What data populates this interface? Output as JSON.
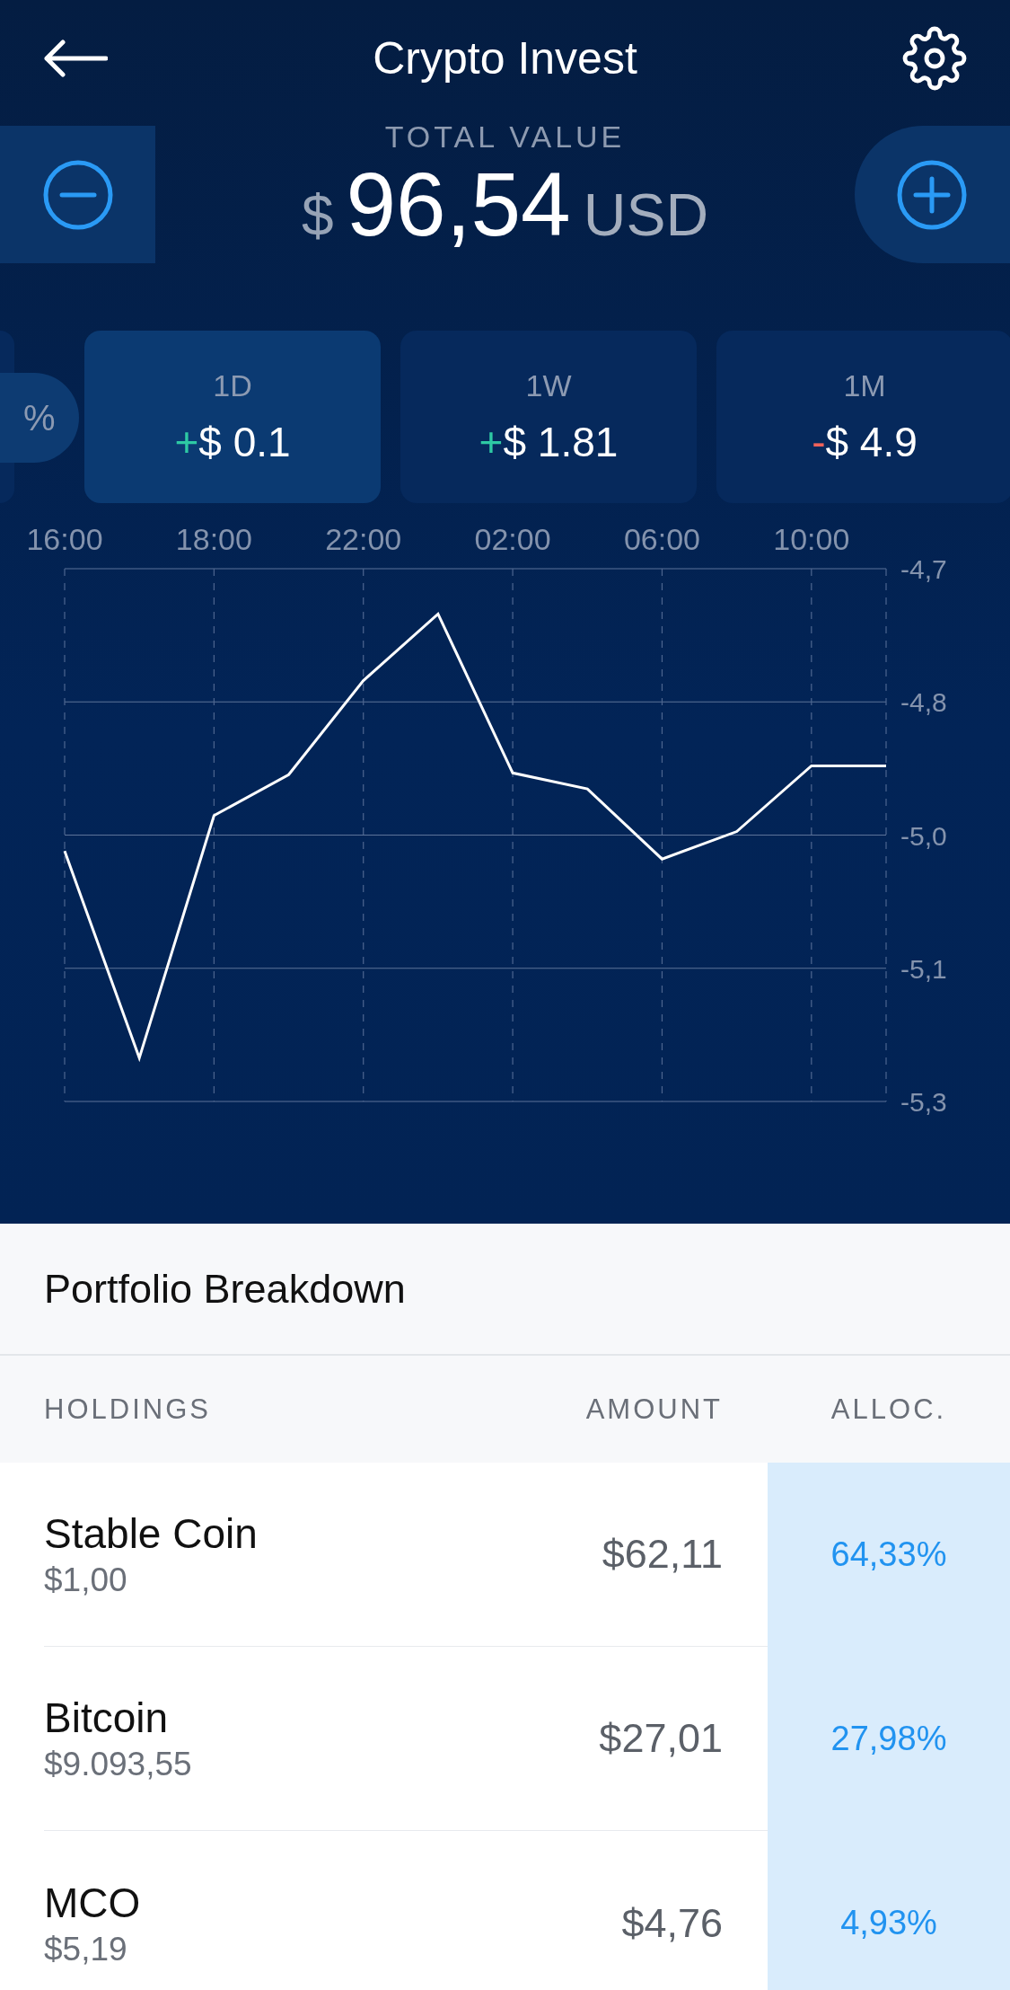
{
  "header": {
    "title": "Crypto Invest"
  },
  "summary": {
    "label": "TOTAL VALUE",
    "currency_symbol": "$",
    "amount": "96,54",
    "currency": "USD"
  },
  "periods": [
    {
      "label": "%",
      "kind": "toggle",
      "selected": false
    },
    {
      "label": "1D",
      "kind": "period",
      "color": "#2ec9a4",
      "sign": "+",
      "value": "$ 0.1",
      "selected": true
    },
    {
      "label": "1W",
      "kind": "period",
      "color": "#2ec9a4",
      "sign": "+",
      "value": "$ 1.81",
      "selected": false
    },
    {
      "label": "1M",
      "kind": "period",
      "color": "#f0625a",
      "sign": "-",
      "value": "$ 4.9",
      "selected": false
    }
  ],
  "chart": {
    "chart_data": {
      "type": "line",
      "categories": [
        "16:00",
        null,
        "18:00",
        null,
        "22:00",
        null,
        "02:00",
        null,
        "06:00",
        null,
        "10:00",
        null
      ],
      "grid": true,
      "ylim": [
        -5.3,
        -4.7
      ],
      "yticks": [
        {
          "value": -4.7,
          "label": "-4,7"
        },
        {
          "value": -4.85,
          "label": "-4,8"
        },
        {
          "value": -5.0,
          "label": "-5,0"
        },
        {
          "value": -5.15,
          "label": "-5,1"
        },
        {
          "value": -5.3,
          "label": "-5,3"
        }
      ],
      "series": [
        {
          "color": "#ffffff",
          "values": [
            -5.018,
            -5.251,
            -4.978,
            -4.932,
            -4.826,
            -4.751,
            -4.93,
            -4.948,
            -5.027,
            -4.996,
            -4.922,
            -4.922
          ]
        }
      ]
    }
  },
  "portfolio": {
    "title": "Portfolio Breakdown",
    "columns": [
      "HOLDINGS",
      "AMOUNT",
      "ALLOC."
    ],
    "rows": [
      {
        "name": "Stable Coin",
        "price": "$1,00",
        "amount": "$62,11",
        "allocation": "64,33%"
      },
      {
        "name": "Bitcoin",
        "price": "$9.093,55",
        "amount": "$27,01",
        "allocation": "27,98%"
      },
      {
        "name": "MCO",
        "price": "$5,19",
        "amount": "$4,76",
        "allocation": "4,93%"
      }
    ]
  }
}
